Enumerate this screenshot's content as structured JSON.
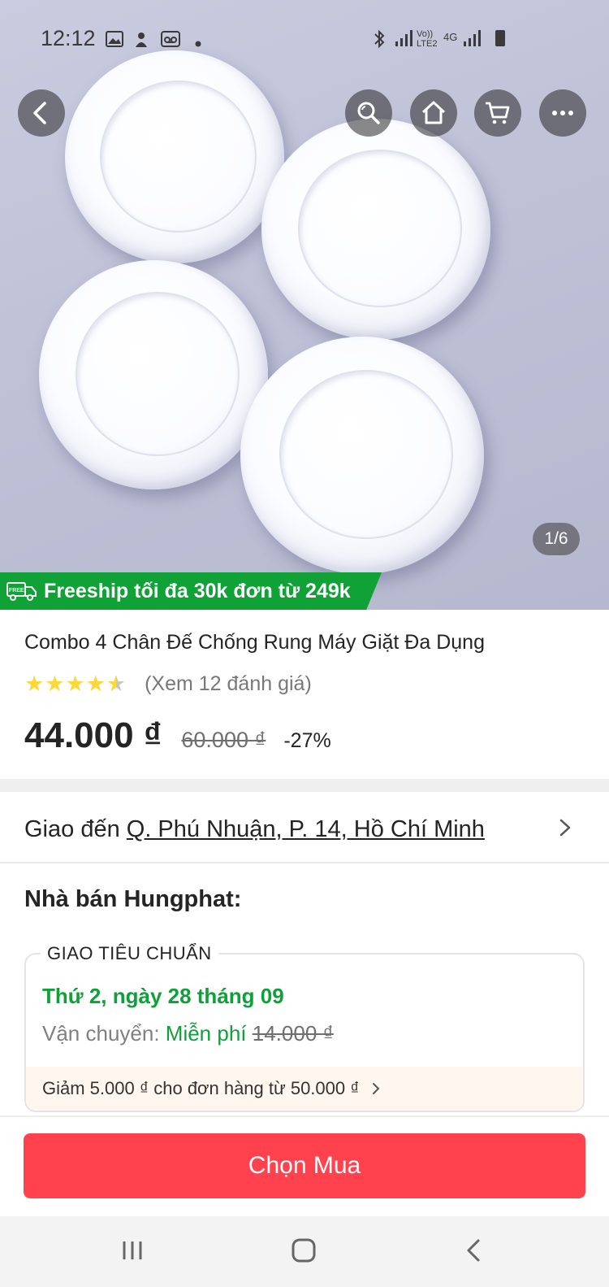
{
  "status_bar": {
    "time": "12:12",
    "icons": [
      "gallery-icon",
      "notification-icon",
      "voicemail-icon",
      "dot-icon",
      "bluetooth-icon",
      "signal-icon",
      "volte-icon",
      "4g-icon",
      "signal-icon",
      "battery-icon"
    ],
    "network_label_1": "Vo)) LTE2",
    "network_label_2": "4G"
  },
  "header": {
    "buttons": [
      "back-icon",
      "search-icon",
      "home-icon",
      "cart-icon",
      "more-icon"
    ]
  },
  "gallery": {
    "counter": "1/6"
  },
  "freeship": {
    "badge_text": "FREE",
    "label": "Freeship tối đa 30k đơn từ 249k"
  },
  "product": {
    "title": "Combo 4 Chân Đế Chống Rung Máy Giặt Đa Dụng",
    "rating": 4.5,
    "reviews": "(Xem 12 đánh giá)",
    "price": "44.000 ₫",
    "old_price": "60.000 ₫",
    "discount": "-27%"
  },
  "delivery": {
    "prefix": "Giao đến ",
    "address": "Q. Phú Nhuận, P. 14, Hồ Chí Minh"
  },
  "seller": {
    "label": "Nhà bán Hungphat:"
  },
  "shipping": {
    "box_label": "GIAO TIÊU CHUẨN",
    "date": "Thứ 2, ngày 28 tháng 09",
    "fee_label": "Vận chuyển: ",
    "fee_free": "Miễn phí",
    "fee_old": "14.000 ₫",
    "promo": "Giảm 5.000 ₫ cho đơn hàng từ 50.000 ₫"
  },
  "actions": {
    "buy_label": "Chọn Mua"
  },
  "colors": {
    "accent_green": "#10a236",
    "buy_red": "#ff424e",
    "star_yellow": "#fdd836"
  }
}
